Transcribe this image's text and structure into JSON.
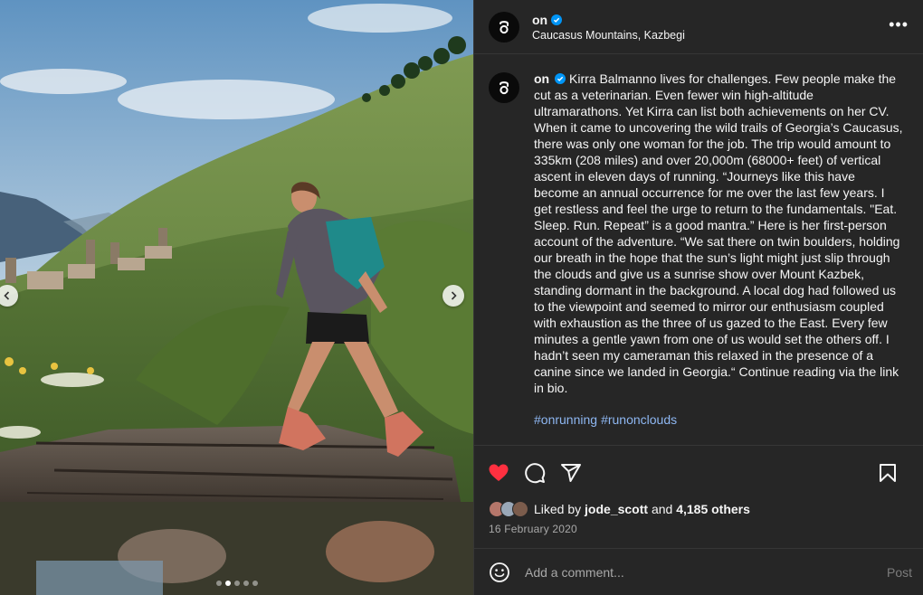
{
  "account": {
    "username": "on",
    "verified": true,
    "location": "Caucasus Mountains, Kazbegi"
  },
  "icons": {
    "more": "more-options-icon",
    "verified": "verified-badge-icon",
    "like": "heart-icon",
    "comment": "comment-icon",
    "share": "share-icon",
    "save": "bookmark-icon",
    "emoji": "emoji-icon",
    "prev": "chevron-left-icon",
    "next": "chevron-right-icon"
  },
  "colors": {
    "panel_bg": "#262626",
    "like_red": "#ff3040",
    "hashtag": "#8eb7f2",
    "verified_blue": "#0095f6"
  },
  "caption": {
    "username": "on",
    "text": "Kirra Balmanno lives for challenges. Few people make the cut as a veterinarian. Even fewer win high-altitude ultramarathons. Yet Kirra can list both achievements on her CV. When it came to uncovering the wild trails of Georgia’s Caucasus, there was only one woman for the job. The trip would amount to 335km (208 miles) and over 20,000m (68000+ feet) of vertical ascent in eleven days of running. “Journeys like this have become an annual occurrence for me over the last few years. I get restless and feel the urge to return to the fundamentals. \"Eat. Sleep. Run. Repeat” is a good mantra.” Here is her first-person account of the adventure. “We sat there on twin boulders, holding our breath in the hope that the sun’s light might just slip through the clouds and give us a sunrise show over Mount Kazbek, standing dormant in the background. A local dog had followed us to the viewpoint and seemed to mirror our enthusiasm coupled with exhaustion as the three of us gazed to the East. Every few minutes a gentle yawn from one of us would set the others off. I hadn’t seen my cameraman this relaxed in the presence of a canine since we landed in Georgia.“ Continue reading via the link in bio.",
    "hashtags": [
      "#onrunning",
      "#runonclouds"
    ]
  },
  "likes": {
    "prefix": "Liked by",
    "first_user": "jode_scott",
    "conjunction": "and",
    "others": "4,185 others"
  },
  "date": "16 February 2020",
  "comment_box": {
    "placeholder": "Add a comment...",
    "post_label": "Post"
  },
  "carousel": {
    "total": 5,
    "active_index": 1
  }
}
